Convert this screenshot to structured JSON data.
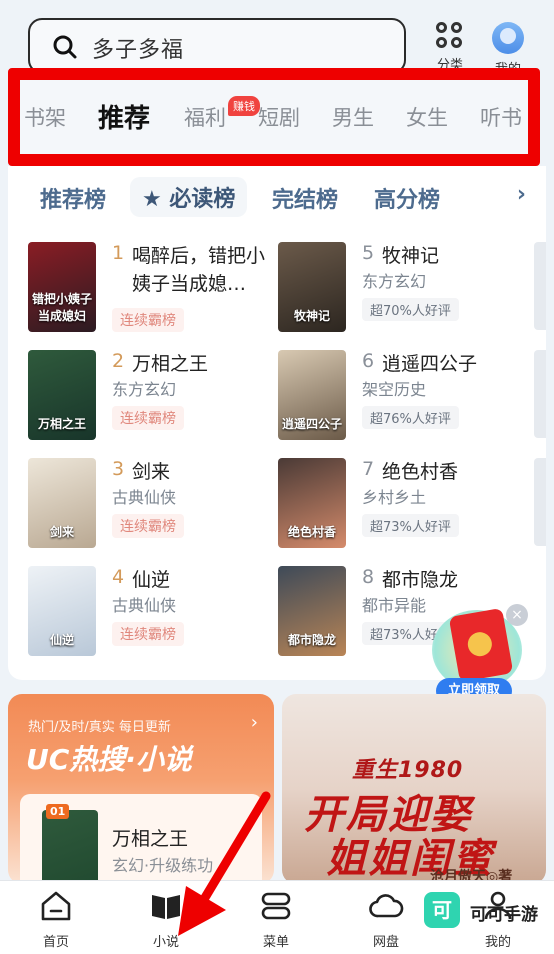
{
  "search": {
    "query": "多子多福"
  },
  "header": {
    "category_label": "分类",
    "me_label": "我的"
  },
  "channels": {
    "items": [
      "书架",
      "推荐",
      "福利",
      "短剧",
      "男生",
      "女生",
      "听书"
    ],
    "active": "推荐",
    "welfare_badge": "赚钱",
    "highlight_color": "#ee0000"
  },
  "rank_tabs": {
    "items": [
      "推荐榜",
      "必读榜",
      "完结榜",
      "高分榜"
    ],
    "active": "必读榜",
    "active_icon": "star-icon",
    "more_icon": "chevron-right-icon"
  },
  "books": [
    {
      "rank": "1",
      "title": "喝醉后，错把小姨子当成媳…",
      "sub": "",
      "tag": "连续霸榜",
      "cover_text": "错把小姨子当成媳妇"
    },
    {
      "rank": "2",
      "title": "万相之王",
      "sub": "东方玄幻",
      "tag": "连续霸榜",
      "cover_text": "万相之王"
    },
    {
      "rank": "3",
      "title": "剑来",
      "sub": "古典仙侠",
      "tag": "连续霸榜",
      "cover_text": "剑来"
    },
    {
      "rank": "4",
      "title": "仙逆",
      "sub": "古典仙侠",
      "tag": "连续霸榜",
      "cover_text": "仙逆"
    },
    {
      "rank": "5",
      "title": "牧神记",
      "sub": "东方玄幻",
      "tag": "超70%人好评",
      "cover_text": "牧神记"
    },
    {
      "rank": "6",
      "title": "逍遥四公子",
      "sub": "架空历史",
      "tag": "超76%人好评",
      "cover_text": "逍遥四公子"
    },
    {
      "rank": "7",
      "title": "绝色村香",
      "sub": "乡村乡土",
      "tag": "超73%人好评",
      "cover_text": "绝色村香"
    },
    {
      "rank": "8",
      "title": "都市隐龙",
      "sub": "都市异能",
      "tag": "超73%人好评",
      "cover_text": "都市隐龙"
    }
  ],
  "envelope": {
    "button": "立即领取",
    "close": "×"
  },
  "hot": {
    "subtitle": "热门/及时/真实 每日更新",
    "title": "UC热搜·小说",
    "book_no": "01",
    "book_title": "万相之王",
    "book_genre": "玄幻·升级练功"
  },
  "promo": {
    "small": "重生1980",
    "big1": "开局迎娶",
    "big2": "姐姐闺蜜",
    "author": "沧月傲天◎著"
  },
  "nav": {
    "items": [
      "首页",
      "小说",
      "菜单",
      "网盘",
      "我的"
    ]
  },
  "watermark": {
    "logo": "可",
    "text": "可可手游"
  }
}
